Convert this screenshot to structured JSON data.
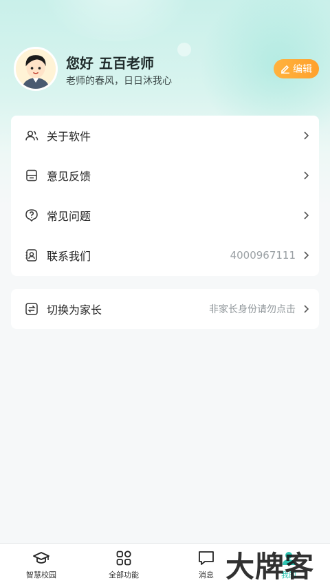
{
  "profile": {
    "hello": "您好",
    "name": "五百老师",
    "motto": "老师的春风，日日沐我心",
    "edit_label": "编辑"
  },
  "menu": [
    {
      "label": "关于软件",
      "icon": "users-icon",
      "value": ""
    },
    {
      "label": "意见反馈",
      "icon": "feedback-icon",
      "value": ""
    },
    {
      "label": "常见问题",
      "icon": "question-icon",
      "value": ""
    },
    {
      "label": "联系我们",
      "icon": "contact-icon",
      "value": "4000967111"
    }
  ],
  "switch_role": {
    "label": "切换为家长",
    "icon": "switch-icon",
    "hint": "非家长身份请勿点击"
  },
  "tabbar": [
    {
      "label": "智慧校园",
      "icon": "graduation-cap-icon",
      "active": false
    },
    {
      "label": "全部功能",
      "icon": "grid-icon",
      "active": false
    },
    {
      "label": "消息",
      "icon": "message-icon",
      "active": false
    },
    {
      "label": "我的",
      "icon": "profile-icon",
      "active": true
    }
  ],
  "watermark": "大牌客",
  "colors": {
    "accent": "#2fc4b2",
    "edit_button": "#ffa12c",
    "header_gradient_top": "#c9f0ea"
  }
}
